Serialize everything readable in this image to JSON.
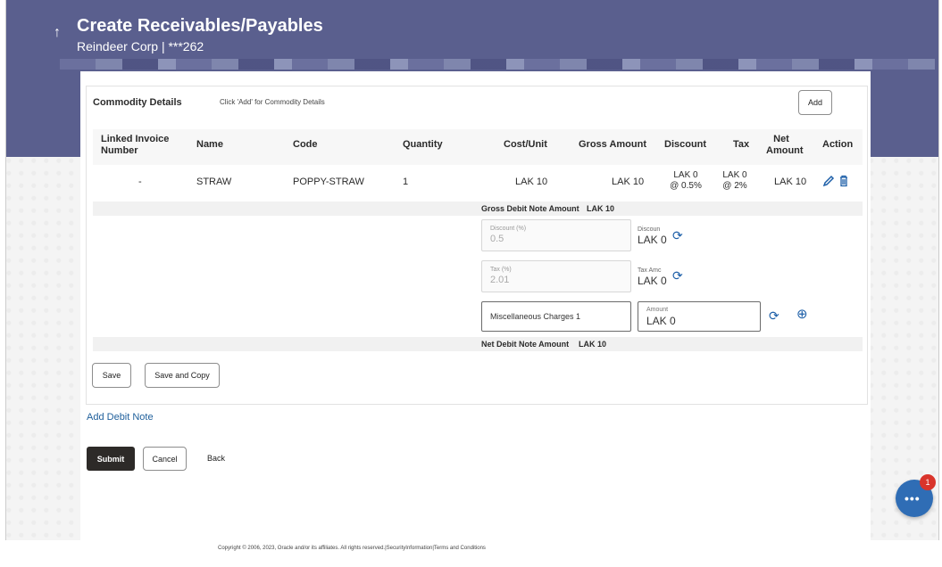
{
  "header": {
    "back_icon": "arrow-up-icon",
    "title": "Create Receivables/Payables",
    "subtitle": "Reindeer Corp | ***262"
  },
  "commodity": {
    "title": "Commodity Details",
    "hint": "Click 'Add' for Commodity Details",
    "add_label": "Add",
    "columns": [
      "Linked Invoice Number",
      "Name",
      "Code",
      "Quantity",
      "Cost/Unit",
      "Gross Amount",
      "Discount",
      "Tax",
      "Net Amount",
      "Action"
    ],
    "rows": [
      {
        "linked_invoice": "-",
        "name": "STRAW",
        "code": "POPPY-STRAW",
        "quantity": "1",
        "cost_unit": "LAK 10",
        "gross_amount": "LAK 10",
        "discount_amount": "LAK 0",
        "discount_rate": "@ 0.5%",
        "tax_amount": "LAK 0",
        "tax_rate": "@ 2%",
        "net_amount": "LAK 10"
      }
    ]
  },
  "gross": {
    "label": "Gross Debit Note Amount",
    "value": "LAK 10"
  },
  "discount": {
    "label": "Discount (%)",
    "value": "0.5",
    "amount_label": "Discoun",
    "amount_value": "LAK 0"
  },
  "tax": {
    "label": "Tax (%)",
    "value": "2.01",
    "amount_label": "Tax Amc",
    "amount_value": "LAK 0"
  },
  "misc": {
    "value": "Miscellaneous Charges 1",
    "amount_label": "Amount",
    "amount_value": "LAK 0"
  },
  "net": {
    "label": "Net Debit Note Amount",
    "value": "LAK 10"
  },
  "actions": {
    "save": "Save",
    "save_copy": "Save and Copy",
    "add_debit": "Add Debit Note",
    "submit": "Submit",
    "cancel": "Cancel",
    "back": "Back"
  },
  "footer": "Copyright © 2006, 2023, Oracle and/or its affiliates. All rights reserved.|SecurityInformation|Terms and Conditions",
  "chat": {
    "badge": "1"
  },
  "colors": {
    "header": "#5a5f8e",
    "accent": "#1d5fa8",
    "submit": "#2d2a28",
    "badge": "#d9342b"
  }
}
